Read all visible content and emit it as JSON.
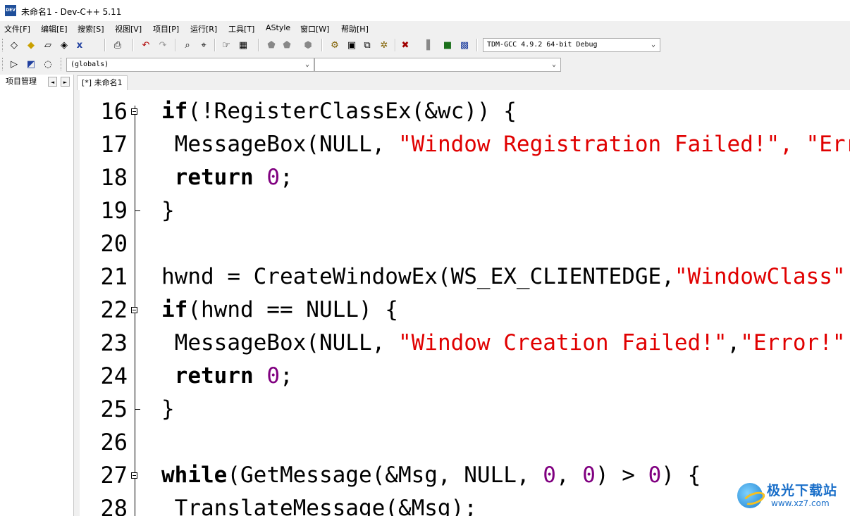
{
  "window": {
    "title": "未命名1 - Dev-C++ 5.11",
    "icon_text": "DEV"
  },
  "menu": [
    "文件[F]",
    "编辑[E]",
    "搜索[S]",
    "视图[V]",
    "项目[P]",
    "运行[R]",
    "工具[T]",
    "AStyle",
    "窗口[W]",
    "帮助[H]"
  ],
  "toolbar": {
    "compiler_select": "TDM-GCC 4.9.2 64-bit Debug",
    "scope_select": "(globals)",
    "member_select": ""
  },
  "left_panel": {
    "tab_label": "项目管理",
    "prev_glyph": "◄",
    "next_glyph": "►"
  },
  "editor": {
    "tab_label": "[*] 未命名1",
    "lines": [
      {
        "no": "16",
        "fold": "open",
        "tokens": [
          [
            "kw",
            "if"
          ],
          [
            "t",
            "(!RegisterClassEx(&wc)) {"
          ]
        ]
      },
      {
        "no": "17",
        "fold": "",
        "tokens": [
          [
            "t",
            " MessageBox(NULL, "
          ],
          [
            "str",
            "\"Window Registration Failed!\", \"Error!\""
          ]
        ]
      },
      {
        "no": "18",
        "fold": "",
        "tokens": [
          [
            "t",
            " "
          ],
          [
            "kw",
            "return"
          ],
          [
            "t",
            " "
          ],
          [
            "num",
            "0"
          ],
          [
            "t",
            ";"
          ]
        ]
      },
      {
        "no": "19",
        "fold": "end",
        "tokens": [
          [
            "t",
            "}"
          ]
        ]
      },
      {
        "no": "20",
        "fold": "",
        "tokens": []
      },
      {
        "no": "21",
        "fold": "",
        "tokens": [
          [
            "t",
            "hwnd = CreateWindowEx(WS_EX_CLIENTEDGE,"
          ],
          [
            "str",
            "\"WindowClass\""
          ]
        ]
      },
      {
        "no": "22",
        "fold": "open",
        "tokens": [
          [
            "kw",
            "if"
          ],
          [
            "t",
            "(hwnd == NULL) {"
          ]
        ]
      },
      {
        "no": "23",
        "fold": "",
        "tokens": [
          [
            "t",
            " MessageBox(NULL, "
          ],
          [
            "str",
            "\"Window Creation Failed!\""
          ],
          [
            "t",
            ","
          ],
          [
            "str",
            "\"Error!\""
          ]
        ]
      },
      {
        "no": "24",
        "fold": "",
        "tokens": [
          [
            "t",
            " "
          ],
          [
            "kw",
            "return"
          ],
          [
            "t",
            " "
          ],
          [
            "num",
            "0"
          ],
          [
            "t",
            ";"
          ]
        ]
      },
      {
        "no": "25",
        "fold": "end",
        "tokens": [
          [
            "t",
            "}"
          ]
        ]
      },
      {
        "no": "26",
        "fold": "",
        "tokens": []
      },
      {
        "no": "27",
        "fold": "open",
        "tokens": [
          [
            "kw",
            "while"
          ],
          [
            "t",
            "(GetMessage(&Msg, NULL, "
          ],
          [
            "num",
            "0"
          ],
          [
            "t",
            ", "
          ],
          [
            "num",
            "0"
          ],
          [
            "t",
            ") > "
          ],
          [
            "num",
            "0"
          ],
          [
            "t",
            ") {"
          ]
        ]
      },
      {
        "no": "28",
        "fold": "",
        "tokens": [
          [
            "t",
            " TranslateMessage(&Msg);"
          ]
        ]
      }
    ]
  },
  "watermark": {
    "text": "极光下载站",
    "url": "www.xz7.com"
  }
}
